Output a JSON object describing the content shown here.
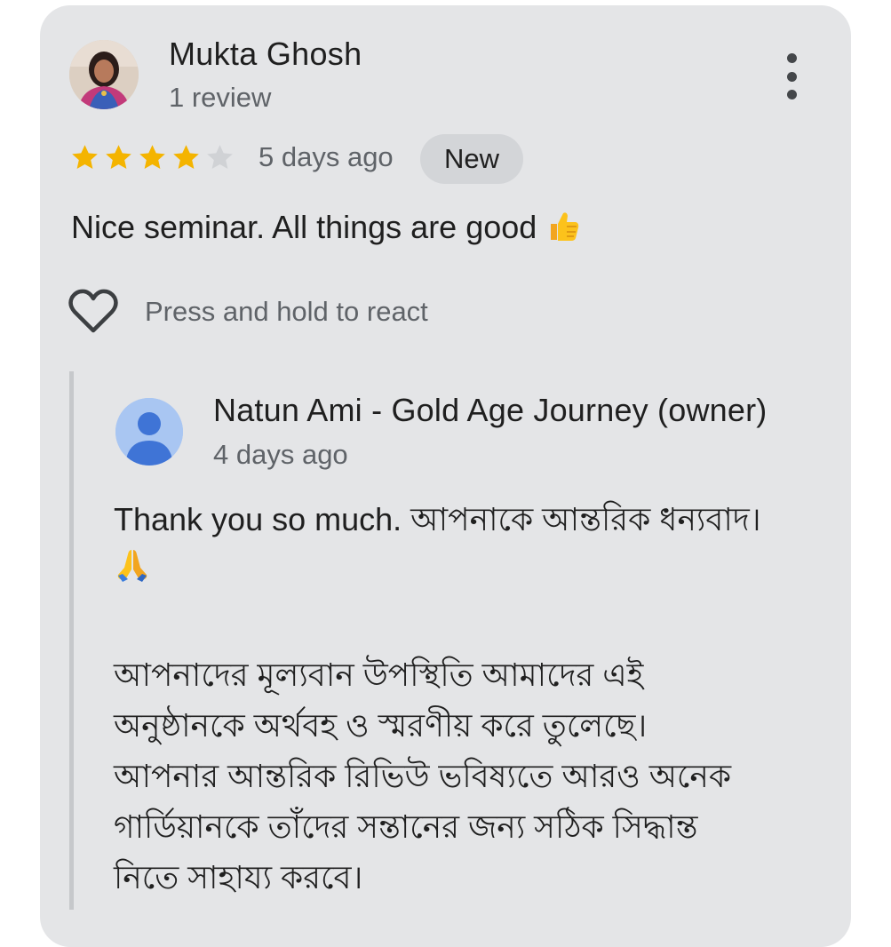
{
  "review": {
    "reviewer_name": "Mukta Ghosh",
    "review_count": "1 review",
    "rating": 4,
    "rating_max": 5,
    "date": "5 days ago",
    "badge": "New",
    "text": "Nice seminar. All things are good",
    "text_emoji": "thumbs-up-emoji",
    "react_hint": "Press and hold to react"
  },
  "reply": {
    "owner_name": "Natun Ami - Gold Age Journey (owner)",
    "date": "4 days ago",
    "line1": "Thank you so much. আপনাকে আন্তরিক ধন্যবাদ।",
    "line1_emoji": "folded-hands-emoji",
    "paragraph": [
      "আপনাদের মূল্যবান উপস্থিতি আমাদের এই",
      "অনুষ্ঠানকে অর্থবহ ও স্মরণীয় করে তুলেছে।",
      "আপনার আন্তরিক রিভিউ ভবিষ্যতে আরও অনেক",
      "গার্ডিয়ানকে তাঁদের সন্তানের জন্য সঠিক সিদ্ধান্ত",
      "নিতে সাহায্য করবে।"
    ]
  },
  "colors": {
    "star_filled": "#f4b400",
    "star_empty": "#d0d2d5",
    "card_bg": "#e4e5e7",
    "owner_avatar_bg": "#a9c6f2",
    "owner_avatar_fg": "#3f74d6"
  },
  "icons": {
    "more": "more-vert-icon",
    "react": "heart-outline-icon"
  }
}
